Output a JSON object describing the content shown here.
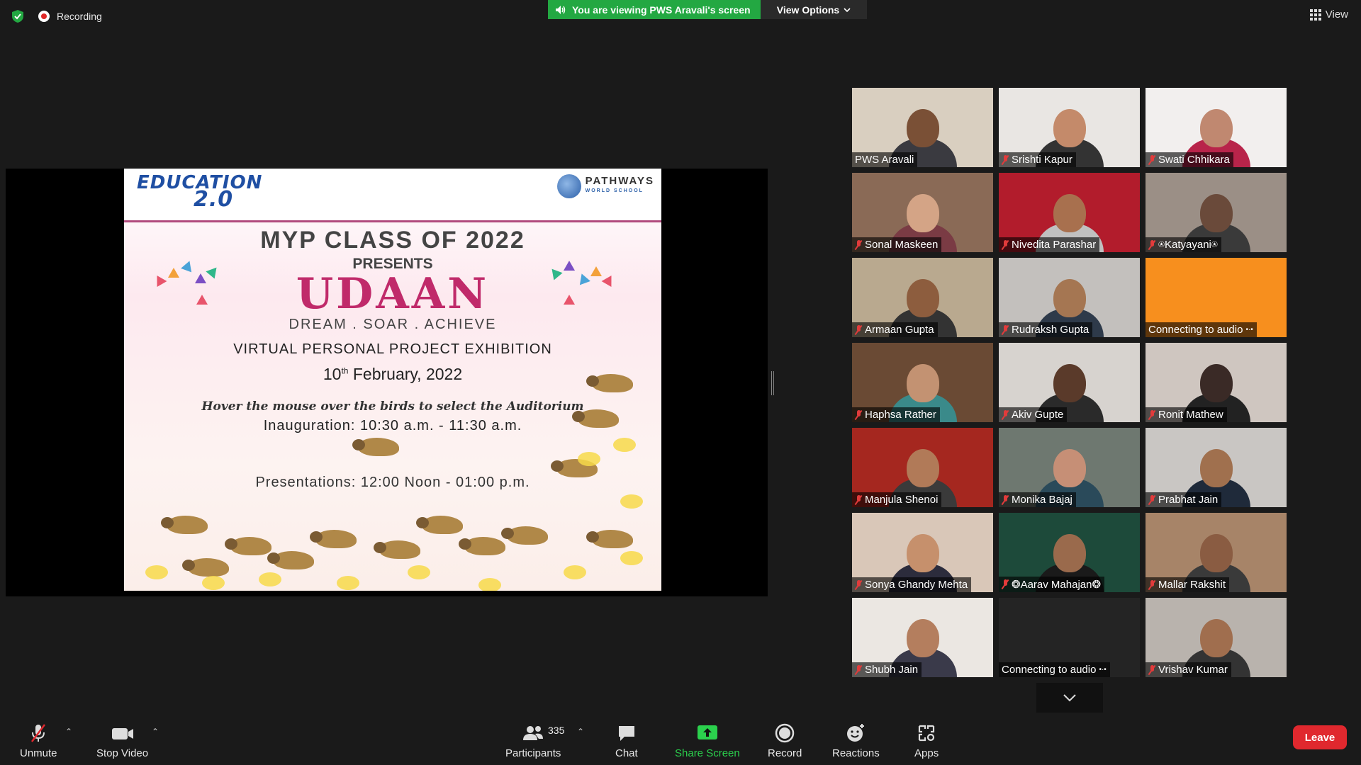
{
  "top": {
    "recording_label": "Recording",
    "banner_text": "You are viewing PWS Aravali's screen",
    "view_options_label": "View Options",
    "view_label": "View"
  },
  "slide": {
    "logo_left_line1": "EDUCATION",
    "logo_left_line2": "2.0",
    "logo_right_name": "PATHWAYS",
    "logo_right_sub": "WORLD SCHOOL",
    "line1": "MYP CLASS OF 2022",
    "line2": "PRESENTS",
    "line3": "UDAAN",
    "line4": "DREAM . SOAR . ACHIEVE",
    "line5": "VIRTUAL PERSONAL PROJECT EXHIBITION",
    "date_day": "10",
    "date_suffix": "th",
    "date_rest": " February, 2022",
    "hover_text": "Hover the mouse over the birds to select the Auditorium",
    "inauguration": "Inauguration: 10:30 a.m. - 11:30 a.m.",
    "presentations": "Presentations: 12:00 Noon - 01:00 p.m."
  },
  "participants": [
    {
      "name": "PWS Aravali",
      "muted": false,
      "bg": "#d9cfc0",
      "skin": "#7a5036",
      "shirt": "#3a3a40"
    },
    {
      "name": "Srishti Kapur",
      "muted": true,
      "bg": "#e9e6e3",
      "skin": "#c48a6a",
      "shirt": "#333"
    },
    {
      "name": "Swati Chhikara",
      "muted": true,
      "bg": "#f2efee",
      "skin": "#c08870",
      "shirt": "#b8244a"
    },
    {
      "name": "Sonal Maskeen",
      "muted": true,
      "bg": "#8a6a56",
      "skin": "#d4a486",
      "shirt": "#7a3b44"
    },
    {
      "name": "Nivedita Parashar",
      "muted": true,
      "bg": "#b21c2c",
      "skin": "#a8704e",
      "shirt": "#c0c0c0"
    },
    {
      "name": "⍟Katyayani⍟",
      "muted": true,
      "bg": "#9b8f86",
      "skin": "#6a4a3a",
      "shirt": "#3a3a3a"
    },
    {
      "name": "Armaan Gupta",
      "muted": true,
      "bg": "#b9a98f",
      "skin": "#8d5d3e",
      "shirt": "#333"
    },
    {
      "name": "Rudraksh Gupta",
      "muted": true,
      "bg": "#c3c0bd",
      "skin": "#a57652",
      "shirt": "#2e3a4a"
    },
    {
      "name": "Connecting to audio",
      "muted": false,
      "bg": "#f78f1e",
      "skin": "",
      "shirt": "",
      "connecting": true
    },
    {
      "name": "Haphsa Rather",
      "muted": true,
      "bg": "#6a4a34",
      "skin": "#c39272",
      "shirt": "#3a8a8a"
    },
    {
      "name": "Akiv Gupte",
      "muted": true,
      "bg": "#d7d3cf",
      "skin": "#5a3a2a",
      "shirt": "#2a2a2a"
    },
    {
      "name": "Ronit Mathew",
      "muted": true,
      "bg": "#cfc6c0",
      "skin": "#3a2a26",
      "shirt": "#222"
    },
    {
      "name": "Manjula Shenoi",
      "muted": true,
      "bg": "#a5271f",
      "skin": "#b17a58",
      "shirt": "#3a3a3a"
    },
    {
      "name": "Monika Bajaj",
      "muted": true,
      "bg": "#6e7870",
      "skin": "#c68f76",
      "shirt": "#2a4a5a",
      "active": true
    },
    {
      "name": "Prabhat Jain",
      "muted": true,
      "bg": "#c9c6c3",
      "skin": "#a0704e",
      "shirt": "#1f2a3a"
    },
    {
      "name": "Sonya Ghandy Mehta",
      "muted": true,
      "bg": "#d9c7b8",
      "skin": "#c6906c",
      "shirt": "#2c2c3c"
    },
    {
      "name": "❂Aarav Mahajan❂",
      "muted": true,
      "bg": "#1d4a3a",
      "skin": "#9a6a4c",
      "shirt": "#1a1a1a"
    },
    {
      "name": "Mallar Rakshit",
      "muted": true,
      "bg": "#a78468",
      "skin": "#8a5c42",
      "shirt": "#3a3a3a"
    },
    {
      "name": "Shubh Jain",
      "muted": true,
      "bg": "#ebe7e2",
      "skin": "#b47e5e",
      "shirt": "#3a3a4a"
    },
    {
      "name": "Connecting to audio",
      "muted": false,
      "bg": "#242424",
      "skin": "",
      "shirt": "",
      "connecting": true
    },
    {
      "name": "Vrishav Kumar",
      "muted": true,
      "bg": "#b9b3ad",
      "skin": "#a06e4e",
      "shirt": "#333"
    }
  ],
  "toolbar": {
    "unmute_label": "Unmute",
    "stop_video_label": "Stop Video",
    "participants_label": "Participants",
    "participants_count": "335",
    "chat_label": "Chat",
    "share_screen_label": "Share Screen",
    "record_label": "Record",
    "reactions_label": "Reactions",
    "apps_label": "Apps",
    "leave_label": "Leave"
  },
  "colors": {
    "green": "#23a842",
    "leave_red": "#e0282e",
    "active_speaker": "#d4e84b"
  }
}
